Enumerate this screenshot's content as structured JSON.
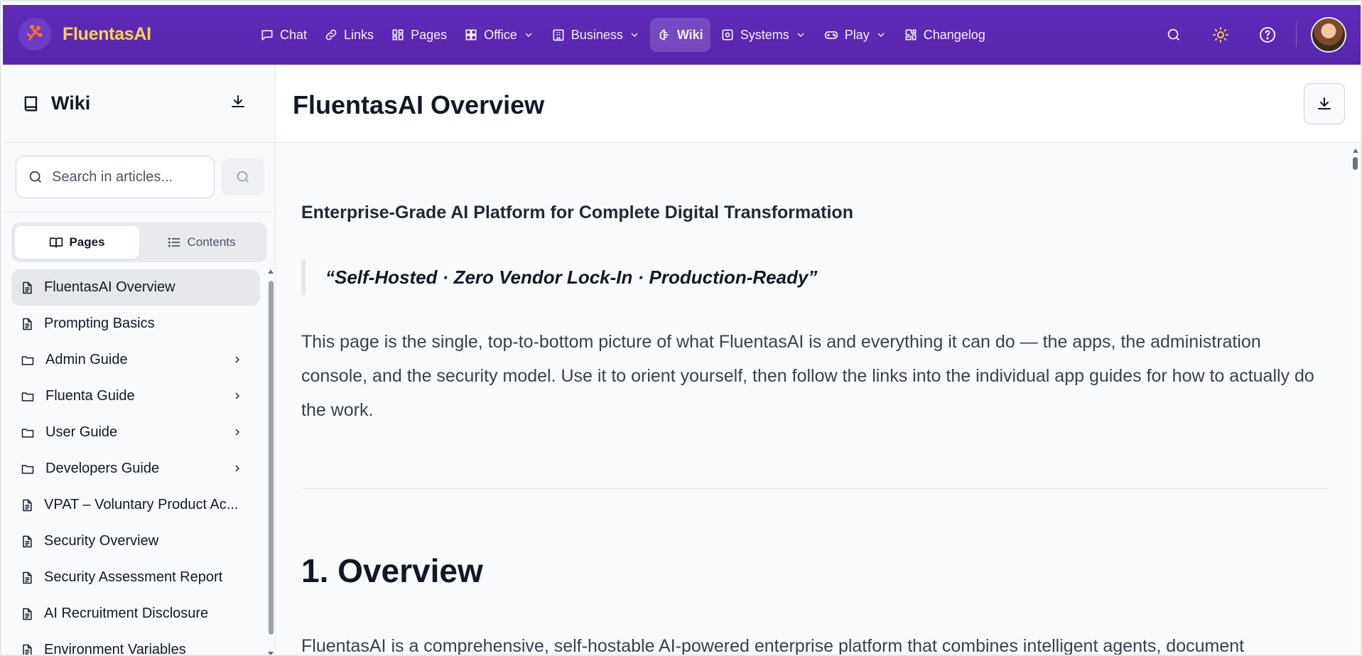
{
  "app": {
    "name": "FluentasAI"
  },
  "nav": {
    "items": [
      {
        "label": "Chat",
        "icon": "chat-bubble-icon"
      },
      {
        "label": "Links",
        "icon": "link-icon"
      },
      {
        "label": "Pages",
        "icon": "pages-icon"
      },
      {
        "label": "Office",
        "icon": "grid-icon",
        "dropdown": true
      },
      {
        "label": "Business",
        "icon": "building-icon",
        "dropdown": true
      },
      {
        "label": "Wiki",
        "icon": "brain-icon",
        "active": true
      },
      {
        "label": "Systems",
        "icon": "systems-icon",
        "dropdown": true
      },
      {
        "label": "Play",
        "icon": "gamepad-icon",
        "dropdown": true
      },
      {
        "label": "Changelog",
        "icon": "puzzle-icon"
      }
    ]
  },
  "sidebar": {
    "title": "Wiki",
    "search_placeholder": "Search in articles...",
    "tabs": [
      {
        "label": "Pages",
        "active": true
      },
      {
        "label": "Contents"
      }
    ],
    "items": [
      {
        "label": "FluentasAI Overview",
        "type": "page",
        "active": true
      },
      {
        "label": "Prompting Basics",
        "type": "page"
      },
      {
        "label": "Admin Guide",
        "type": "folder"
      },
      {
        "label": "Fluenta Guide",
        "type": "folder"
      },
      {
        "label": "User Guide",
        "type": "folder"
      },
      {
        "label": "Developers Guide",
        "type": "folder"
      },
      {
        "label": "VPAT – Voluntary Product Ac...",
        "type": "page"
      },
      {
        "label": "Security Overview",
        "type": "page"
      },
      {
        "label": "Security Assessment Report",
        "type": "page"
      },
      {
        "label": "AI Recruitment Disclosure",
        "type": "page"
      },
      {
        "label": "Environment Variables",
        "type": "page"
      }
    ]
  },
  "main": {
    "title": "FluentasAI Overview",
    "subtitle": "Enterprise-Grade AI Platform for Complete Digital Transformation",
    "quote": "“Self-Hosted · Zero Vendor Lock-In · Production-Ready”",
    "intro": "This page is the single, top-to-bottom picture of what FluentasAI is and everything it can do — the apps, the administration console, and the security model. Use it to orient yourself, then follow the links into the individual app guides for how to actually do the work.",
    "section_heading": "1. Overview",
    "section_text": "FluentasAI is a comprehensive, self-hostable AI-powered enterprise platform that combines intelligent agents, document"
  },
  "colors": {
    "nav_bg": "#5b21b6",
    "brand_text": "#fcd34d",
    "active_item": "#e5e7eb"
  }
}
